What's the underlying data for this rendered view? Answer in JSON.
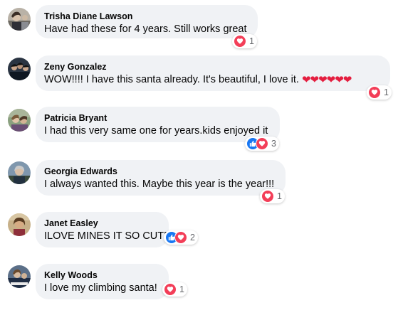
{
  "colors": {
    "bubble_bg": "#f0f2f5",
    "text": "#050505",
    "muted": "#65676b",
    "love": "#f33e58",
    "like": "#1877f2"
  },
  "comments": [
    {
      "author": "Trisha Diane Lawson",
      "text": "Have had these for 4 years. Still works great",
      "trailing": "",
      "reactions": [
        "love-icon"
      ],
      "count": "1"
    },
    {
      "author": "Zeny Gonzalez",
      "text": "WOW!!!! I have this santa already. It's beautiful, I love it. ",
      "trailing": "❤❤❤❤❤❤",
      "reactions": [
        "love-icon"
      ],
      "count": "1"
    },
    {
      "author": "Patricia Bryant",
      "text": "I had this very same one for years.kids enjoyed it",
      "trailing": "",
      "reactions": [
        "like-icon",
        "love-icon"
      ],
      "count": "3"
    },
    {
      "author": "Georgia Edwards",
      "text": "I always wanted this. Maybe this year is the year!!!",
      "trailing": "",
      "reactions": [
        "love-icon"
      ],
      "count": "1"
    },
    {
      "author": "Janet Easley",
      "text": "ILOVE MINES IT SO CUTE",
      "trailing": "",
      "reactions": [
        "like-icon",
        "love-icon"
      ],
      "count": "2"
    },
    {
      "author": "Kelly Woods",
      "text": "I love my climbing santa!",
      "trailing": "",
      "reactions": [
        "love-icon"
      ],
      "count": "1"
    }
  ]
}
